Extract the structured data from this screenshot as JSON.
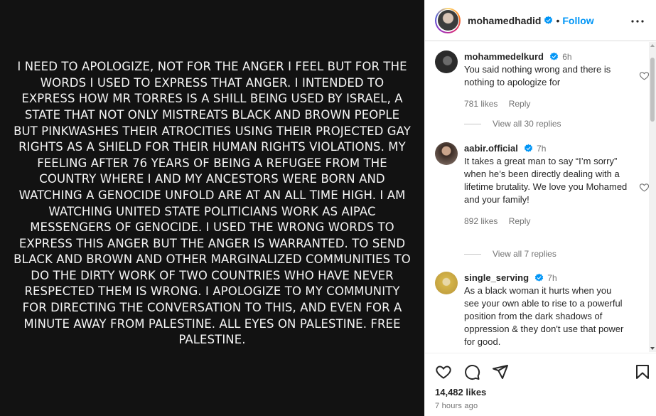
{
  "post": {
    "text": "I need to apologize, not for the anger I feel but for the words I used to express that anger. I intended to express how Mr Torres is a shill being used by Israel, a state that not only mistreats Black and Brown people but pinkwashes their atrocities using their projected gay rights as a shield for their human rights violations. My feeling after 76 years of being a refugee from the country where I and my ancestors were born and watching a genocide unfold are at an all time high. I am watching United State politicians work as AIPAC messengers of genocide. I used the wrong words to express this anger but the anger is warranted. To send Black and Brown and other marginalized communities to do the dirty work of two countries who have never respected them is wrong. I apologize to my community for directing the conversation to this, and even for a minute away from Palestine. All eyes on Palestine. Free Palestine."
  },
  "header": {
    "username": "mohamedhadid",
    "separator": "•",
    "follow_label": "Follow"
  },
  "comments": [
    {
      "user": "mohammedelkurd",
      "time": "6h",
      "text": "You said nothing wrong and there is nothing to apologize for",
      "likes": "781 likes",
      "reply_label": "Reply",
      "view_replies": "View all 30 replies"
    },
    {
      "user": "aabir.official",
      "time": "7h",
      "text": "It takes a great man to say “I’m sorry” when he’s been directly dealing with a lifetime brutality. We love you Mohamed and your family!",
      "likes": "892 likes",
      "reply_label": "Reply",
      "view_replies": "View all 7 replies"
    },
    {
      "user": "single_serving",
      "time": "7h",
      "text": "As a black woman it hurts when you see your own able to rise to a powerful position from the dark shadows of oppression & they don't use that power for good."
    }
  ],
  "footer": {
    "likes": "14,482 likes",
    "time_ago": "7 hours ago"
  },
  "colors": {
    "accent": "#0095f6",
    "verified": "#0095f6",
    "post_bg": "#121212",
    "post_text": "#f5f5f5"
  },
  "icons": [
    "more-icon",
    "heart-icon",
    "comment-icon",
    "share-icon",
    "bookmark-icon",
    "verified-icon"
  ]
}
